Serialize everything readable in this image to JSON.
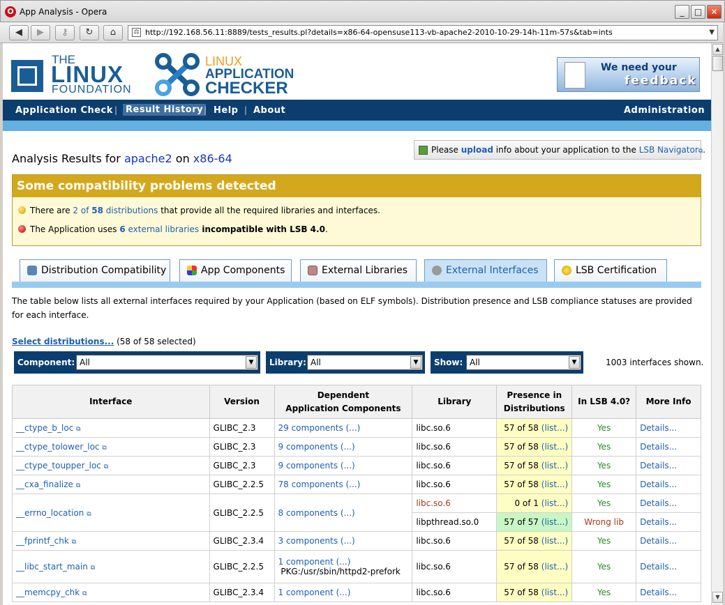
{
  "window": {
    "title": "App Analysis - Opera",
    "url": "http://192.168.56.11:8889/tests_results.pl?details=x86-64-opensuse113-vb-apache2-2010-10-29-14h-11m-57s&tab=ints"
  },
  "logos": {
    "lf_the": "THE",
    "lf_linux": "LINUX",
    "lf_foundation": "FOUNDATION",
    "lac_linux": "LINUX",
    "lac_application": "APPLICATION",
    "lac_checker": "CHECKER"
  },
  "feedback": {
    "line1": "We need your",
    "line2": "feedback"
  },
  "nav": {
    "items": [
      "Application Check",
      "Result History",
      "Help",
      "About"
    ],
    "admin": "Administration"
  },
  "upload": {
    "prefix": "Please ",
    "link": "upload",
    "middle": " info about your application to the ",
    "nav_link": "LSB Navigator",
    "suffix": "."
  },
  "analysis": {
    "prefix": "Analysis Results for ",
    "app": "apache2",
    "on": " on ",
    "arch": "x86-64"
  },
  "warning": {
    "title": "Some compatibility problems detected",
    "line1": {
      "a": "There are ",
      "b": "2",
      "c": " of ",
      "d": "58",
      "e": " distributions",
      "f": " that provide all the required libraries and interfaces."
    },
    "line2": {
      "a": "The Application uses ",
      "b": "6",
      "c": " external libraries",
      "d": " incompatible with LSB 4.0",
      "e": "."
    }
  },
  "tabs": [
    "Distribution Compatibility",
    "App Components",
    "External Libraries",
    "External Interfaces",
    "LSB Certification"
  ],
  "description": "The table below lists all external interfaces required by your Application (based on ELF symbols). Distribution presence and LSB compliance statuses are provided for each interface.",
  "select": {
    "link": "Select distributions...",
    "count": " (58 of 58 selected)"
  },
  "filters": {
    "component_label": "Component:",
    "component_value": "All",
    "library_label": "Library:",
    "library_value": "All",
    "show_label": "Show:",
    "show_value": "All"
  },
  "shown": "1003 interfaces shown.",
  "table": {
    "headers": {
      "interface": "Interface",
      "version": "Version",
      "dep1": "Dependent",
      "dep2": "Application Components",
      "library": "Library",
      "pres1": "Presence in",
      "pres2": "Distributions",
      "lsb": "In LSB 4.0?",
      "more": "More Info"
    },
    "rows": [
      {
        "iface": "__ctype_b_loc",
        "version": "GLIBC_2.3",
        "comp": "29 components (...)",
        "lib": "libc.so.6",
        "pres": "57 of 58",
        "list": "(list...)",
        "lsb": "Yes",
        "details": "Details..."
      },
      {
        "iface": "__ctype_tolower_loc",
        "version": "GLIBC_2.3",
        "comp": "9 components (...)",
        "lib": "libc.so.6",
        "pres": "57 of 58",
        "list": "(list...)",
        "lsb": "Yes",
        "details": "Details..."
      },
      {
        "iface": "__ctype_toupper_loc",
        "version": "GLIBC_2.3",
        "comp": "9 components (...)",
        "lib": "libc.so.6",
        "pres": "57 of 58",
        "list": "(list...)",
        "lsb": "Yes",
        "details": "Details..."
      },
      {
        "iface": "__cxa_finalize",
        "version": "GLIBC_2.2.5",
        "comp": "78 components (...)",
        "lib": "libc.so.6",
        "pres": "57 of 58",
        "list": "(list...)",
        "lsb": "Yes",
        "details": "Details..."
      },
      {
        "iface": "__errno_location",
        "version": "GLIBC_2.2.5",
        "comp": "8 components (...)",
        "lib": "libc.so.6",
        "pres": "0 of 1",
        "list": "(list...)",
        "lsb": "Yes",
        "details": "Details...",
        "lib2": "libpthread.so.0",
        "pres2": "57 of 57",
        "list2": "(list...)",
        "lsb2": "Wrong lib",
        "details2": "Details..."
      },
      {
        "iface": "__fprintf_chk",
        "version": "GLIBC_2.3.4",
        "comp": "3 components (...)",
        "lib": "libc.so.6",
        "pres": "57 of 58",
        "list": "(list...)",
        "lsb": "Yes",
        "details": "Details..."
      },
      {
        "iface": "__libc_start_main",
        "version": "GLIBC_2.2.5",
        "comp": "1 component (...)",
        "comp2": "PKG:/usr/sbin/httpd2-prefork",
        "lib": "libc.so.6",
        "pres": "57 of 58",
        "list": "(list...)",
        "lsb": "Yes",
        "details": "Details..."
      },
      {
        "iface": "__memcpy_chk",
        "version": "GLIBC_2.3.4",
        "comp": "1 component (...)",
        "lib": "libc.so.6",
        "pres": "57 of 58",
        "list": "(list...)",
        "lsb": "Yes",
        "details": "Details..."
      }
    ]
  }
}
